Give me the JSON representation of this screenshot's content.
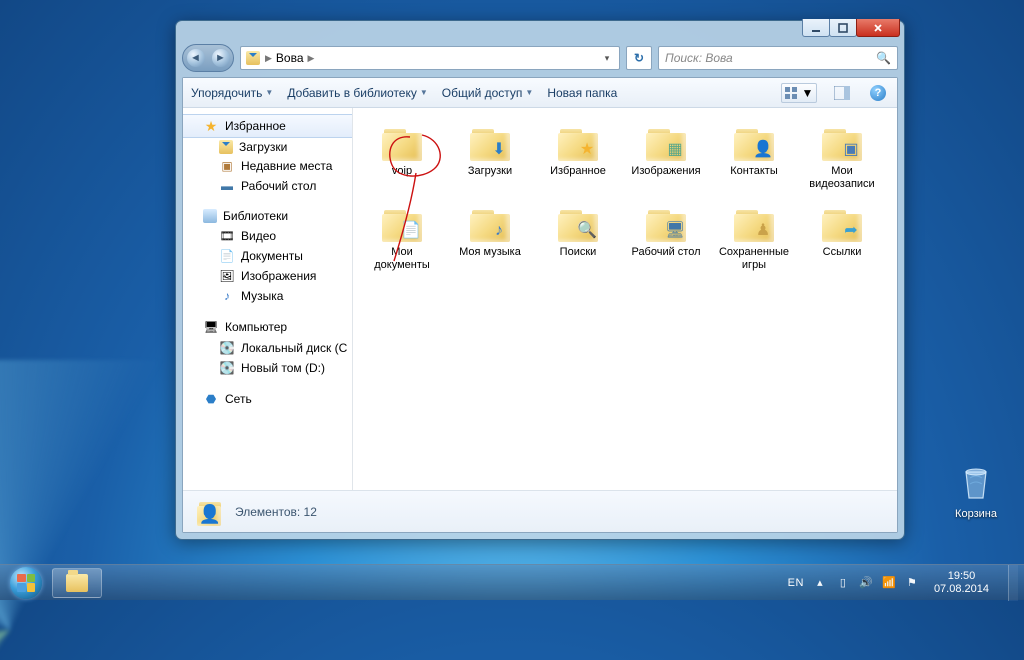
{
  "window": {
    "path_root_icon": "user-folder",
    "path_segments": [
      "Вова"
    ],
    "search_placeholder": "Поиск: Вова"
  },
  "toolbar": {
    "organize": "Упорядочить",
    "add_library": "Добавить в библиотеку",
    "share": "Общий доступ",
    "new_folder": "Новая папка"
  },
  "sidebar": {
    "favorites": {
      "title": "Избранное",
      "items": [
        "Загрузки",
        "Недавние места",
        "Рабочий стол"
      ]
    },
    "libraries": {
      "title": "Библиотеки",
      "items": [
        "Видео",
        "Документы",
        "Изображения",
        "Музыка"
      ]
    },
    "computer": {
      "title": "Компьютер",
      "items": [
        "Локальный диск (C",
        "Новый том (D:)"
      ]
    },
    "network": {
      "title": "Сеть"
    }
  },
  "folders": [
    {
      "name": "voip",
      "overlay": ""
    },
    {
      "name": "Загрузки",
      "overlay": "⬇",
      "oc": "#2b7ec8"
    },
    {
      "name": "Избранное",
      "overlay": "★",
      "oc": "#f5b430"
    },
    {
      "name": "Изображения",
      "overlay": "▦",
      "oc": "#5aa78a"
    },
    {
      "name": "Контакты",
      "overlay": "👤",
      "oc": "#c77b3a"
    },
    {
      "name": "Мои видеозаписи",
      "overlay": "▣",
      "oc": "#4a7bb5"
    },
    {
      "name": "Мои документы",
      "overlay": "📄",
      "oc": "#d9d9d9"
    },
    {
      "name": "Моя музыка",
      "overlay": "♪",
      "oc": "#3a7bc8"
    },
    {
      "name": "Поиски",
      "overlay": "🔍",
      "oc": "#6a8aa8"
    },
    {
      "name": "Рабочий стол",
      "overlay": "🖥",
      "oc": "#4178a8"
    },
    {
      "name": "Сохраненные игры",
      "overlay": "♟",
      "oc": "#caa24a"
    },
    {
      "name": "Ссылки",
      "overlay": "➦",
      "oc": "#3aa0d0"
    }
  ],
  "details": {
    "count_label": "Элементов: 12"
  },
  "desktop": {
    "recycle_bin": "Корзина"
  },
  "tray": {
    "lang": "EN",
    "time": "19:50",
    "date": "07.08.2014"
  }
}
